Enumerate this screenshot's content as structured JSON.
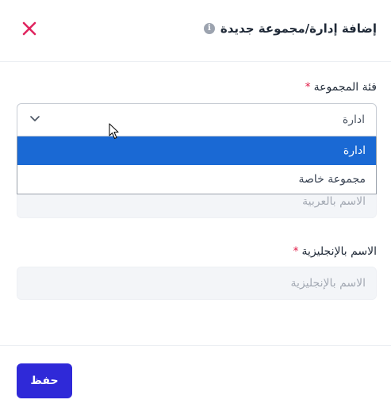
{
  "dialog": {
    "title": "إضافة إدارة/مجموعة جديدة",
    "info_icon": "info-icon",
    "close_icon": "close-icon"
  },
  "form": {
    "group_category": {
      "label": "فئة المجموعة",
      "required_mark": "*",
      "value": "ادارة",
      "options": [
        "ادارة",
        "مجموعة خاصة"
      ],
      "selected_index": 0
    },
    "name_ar": {
      "placeholder": "الاسم بالعربية"
    },
    "name_en": {
      "label": "الاسم بالإنجليزية",
      "required_mark": "*",
      "placeholder": "الاسم بالإنجليزية"
    }
  },
  "footer": {
    "save_label": "حفظ"
  },
  "colors": {
    "accent": "#2f29d8",
    "selected_option": "#1a69d4",
    "required": "#e11d48",
    "close": "#e0245e"
  }
}
